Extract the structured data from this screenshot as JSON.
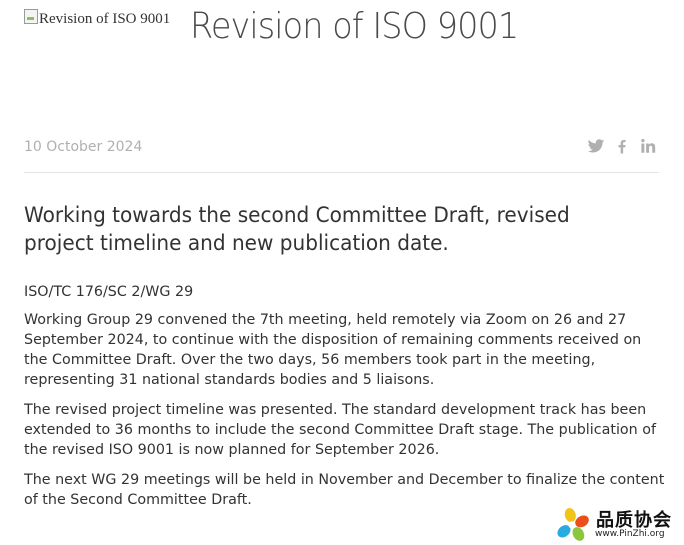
{
  "header": {
    "image_alt": "Revision of ISO 9001",
    "title": "Revision of ISO 9001"
  },
  "meta": {
    "date": "10 October 2024",
    "share_icons": [
      "twitter-icon",
      "facebook-icon",
      "linkedin-icon"
    ],
    "share_icon_color": "#b0b0b0"
  },
  "article": {
    "subtitle": "Working towards the second Committee Draft, revised project timeline and new publication date.",
    "committee": "ISO/TC 176/SC 2/WG 29",
    "paragraphs": [
      "Working Group 29 convened the 7th meeting, held remotely via Zoom on 26 and 27 September 2024, to continue with the disposition of remaining comments received on the Committee Draft. Over the two days, 56 members took part in the meeting, representing 31 national standards bodies and 5 liaisons.",
      "The revised project timeline was presented.  The standard development track has been extended to 36 months to include the second Committee Draft stage. The publication of the revised ISO 9001 is now planned for September 2026.",
      "The next WG 29 meetings will be held in November and December to finalize the content of the Second Committee Draft."
    ]
  },
  "watermark": {
    "name": "品质协会",
    "url": "www.PinZhi.org"
  }
}
